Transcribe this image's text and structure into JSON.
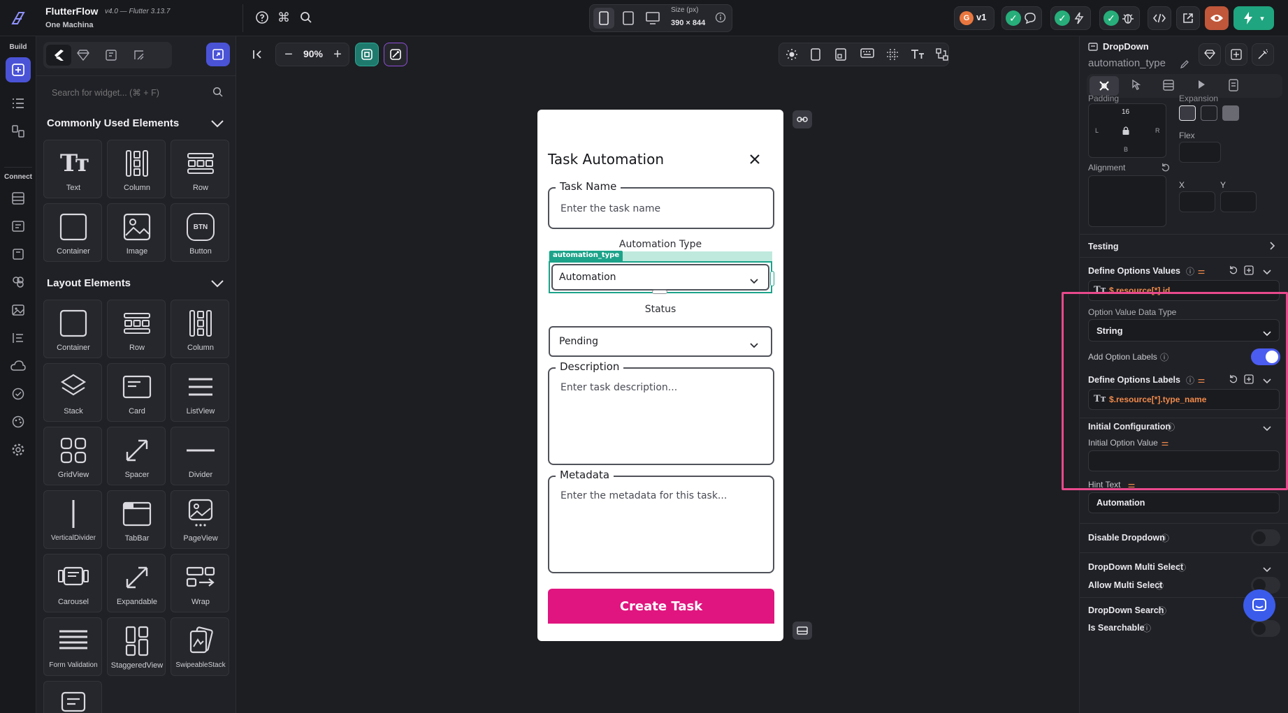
{
  "app": {
    "name": "FlutterFlow",
    "version": "v4.0 — Flutter 3.13.7",
    "project": "One Machina",
    "branch_badge": "v1",
    "size_label": "Size (px)",
    "size_value": "390 × 844",
    "zoom": "90%"
  },
  "rail": {
    "build_label": "Build",
    "connect_label": "Connect"
  },
  "widgets": {
    "search_placeholder": "Search for widget... (⌘ + F)",
    "sections": [
      {
        "title": "Commonly Used Elements",
        "items": [
          "Text",
          "Column",
          "Row",
          "Container",
          "Image",
          "Button"
        ]
      },
      {
        "title": "Layout Elements",
        "items": [
          "Container",
          "Row",
          "Column",
          "Stack",
          "Card",
          "ListView",
          "GridView",
          "Spacer",
          "Divider",
          "VerticalDivider",
          "TabBar",
          "PageView",
          "Carousel",
          "Expandable",
          "Wrap",
          "Form Validation",
          "StaggeredView",
          "SwipeableStack"
        ]
      }
    ],
    "button_icon_text": "BTN"
  },
  "dialog": {
    "title": "Task Automation",
    "task_name_label": "Task Name",
    "task_name_placeholder": "Enter the task name",
    "automation_type_label": "Automation Type",
    "selected_widget_tag": "automation_type",
    "automation_value": "Automation",
    "status_label": "Status",
    "status_value": "Pending",
    "description_label": "Description",
    "description_placeholder": "Enter task description...",
    "metadata_label": "Metadata",
    "metadata_placeholder": "Enter the metadata for this task...",
    "submit_label": "Create Task",
    "accent": "#e0157f",
    "selection": "#1ca38a"
  },
  "props": {
    "widget_type": "DropDown",
    "widget_name": "automation_type",
    "padding_label": "Padding",
    "padding_top": "16",
    "padding_left": "L",
    "padding_right": "R",
    "padding_bottom": "B",
    "expansion_label": "Expansion",
    "flex_label": "Flex",
    "alignment_label": "Alignment",
    "x_label": "X",
    "y_label": "Y",
    "testing_label": "Testing",
    "define_values_label": "Define Options Values",
    "define_values_value": "$.resource[*].id",
    "option_type_label": "Option Value Data Type",
    "option_type_value": "String",
    "add_labels_label": "Add Option Labels",
    "add_labels_on": true,
    "define_labels_label": "Define Options Labels",
    "define_labels_value": "$.resource[*].type_name",
    "initial_config_label": "Initial Configuration",
    "initial_value_label": "Initial Option Value",
    "hint_text_label": "Hint Text",
    "hint_text_value": "Automation",
    "disable_label": "Disable Dropdown",
    "multi_select_label": "DropDown Multi Select",
    "allow_multi_label": "Allow Multi Select",
    "search_label": "DropDown Search",
    "searchable_label": "Is Searchable",
    "binding_color": "#f08a4b",
    "toggle_color": "#4b5cf0",
    "highlight_color": "#e8498c"
  }
}
